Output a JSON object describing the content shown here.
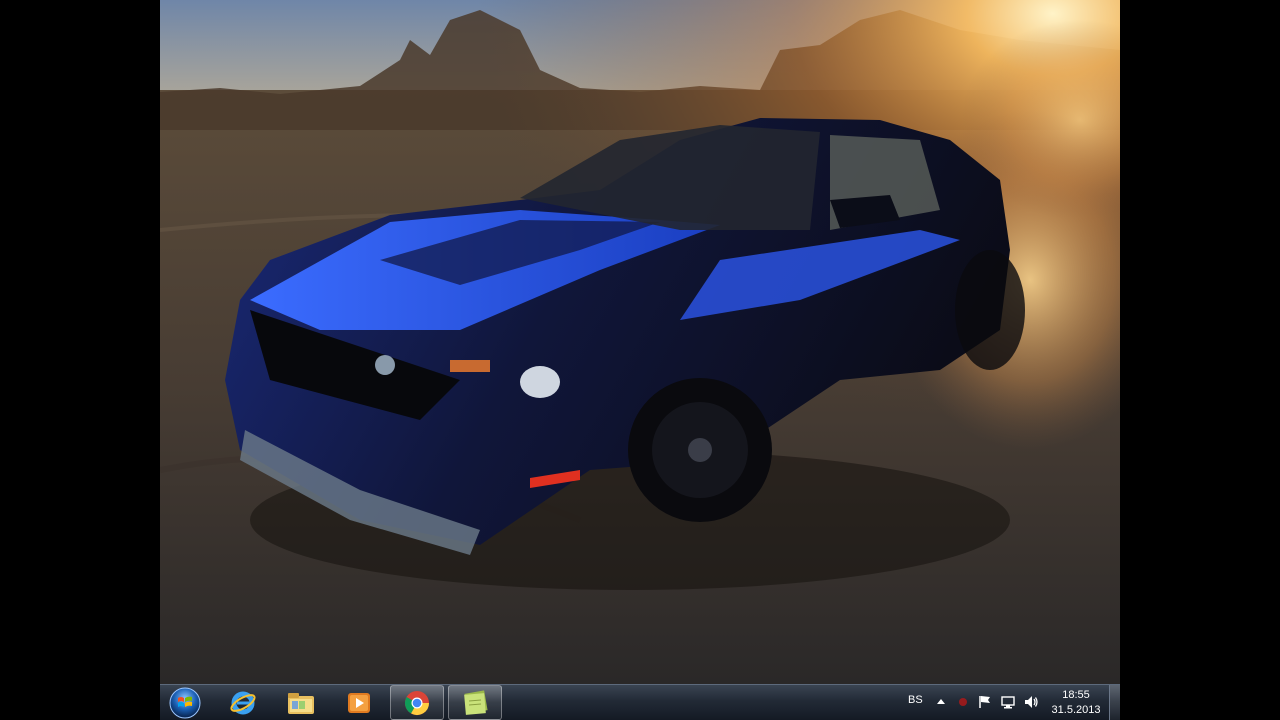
{
  "desktop": {
    "wallpaper": "blue-black-mustang-drifting-at-sunset"
  },
  "taskbar": {
    "start_button": "windows-start-orb-icon",
    "pinned": [
      {
        "name": "internet-explorer",
        "icon": "internet-explorer-icon",
        "active": false
      },
      {
        "name": "windows-explorer",
        "icon": "folder-library-icon",
        "active": false
      },
      {
        "name": "media-player",
        "icon": "media-player-icon",
        "active": false
      },
      {
        "name": "google-chrome",
        "icon": "chrome-icon",
        "active": true
      },
      {
        "name": "sticky-notes",
        "icon": "sticky-notes-icon",
        "active": true
      }
    ],
    "tray": {
      "language": "BS",
      "show_hidden_icon": "up-arrow-icon",
      "icons": [
        "red-status-icon",
        "action-center-flag-icon",
        "network-icon",
        "volume-icon"
      ],
      "time": "18:55",
      "date": "31.5.2013"
    }
  },
  "colors": {
    "taskbar_top": "#3a4452",
    "taskbar_bottom": "#141a24",
    "car_blue": "#1e4fd6",
    "sunlight": "#ffb040"
  }
}
